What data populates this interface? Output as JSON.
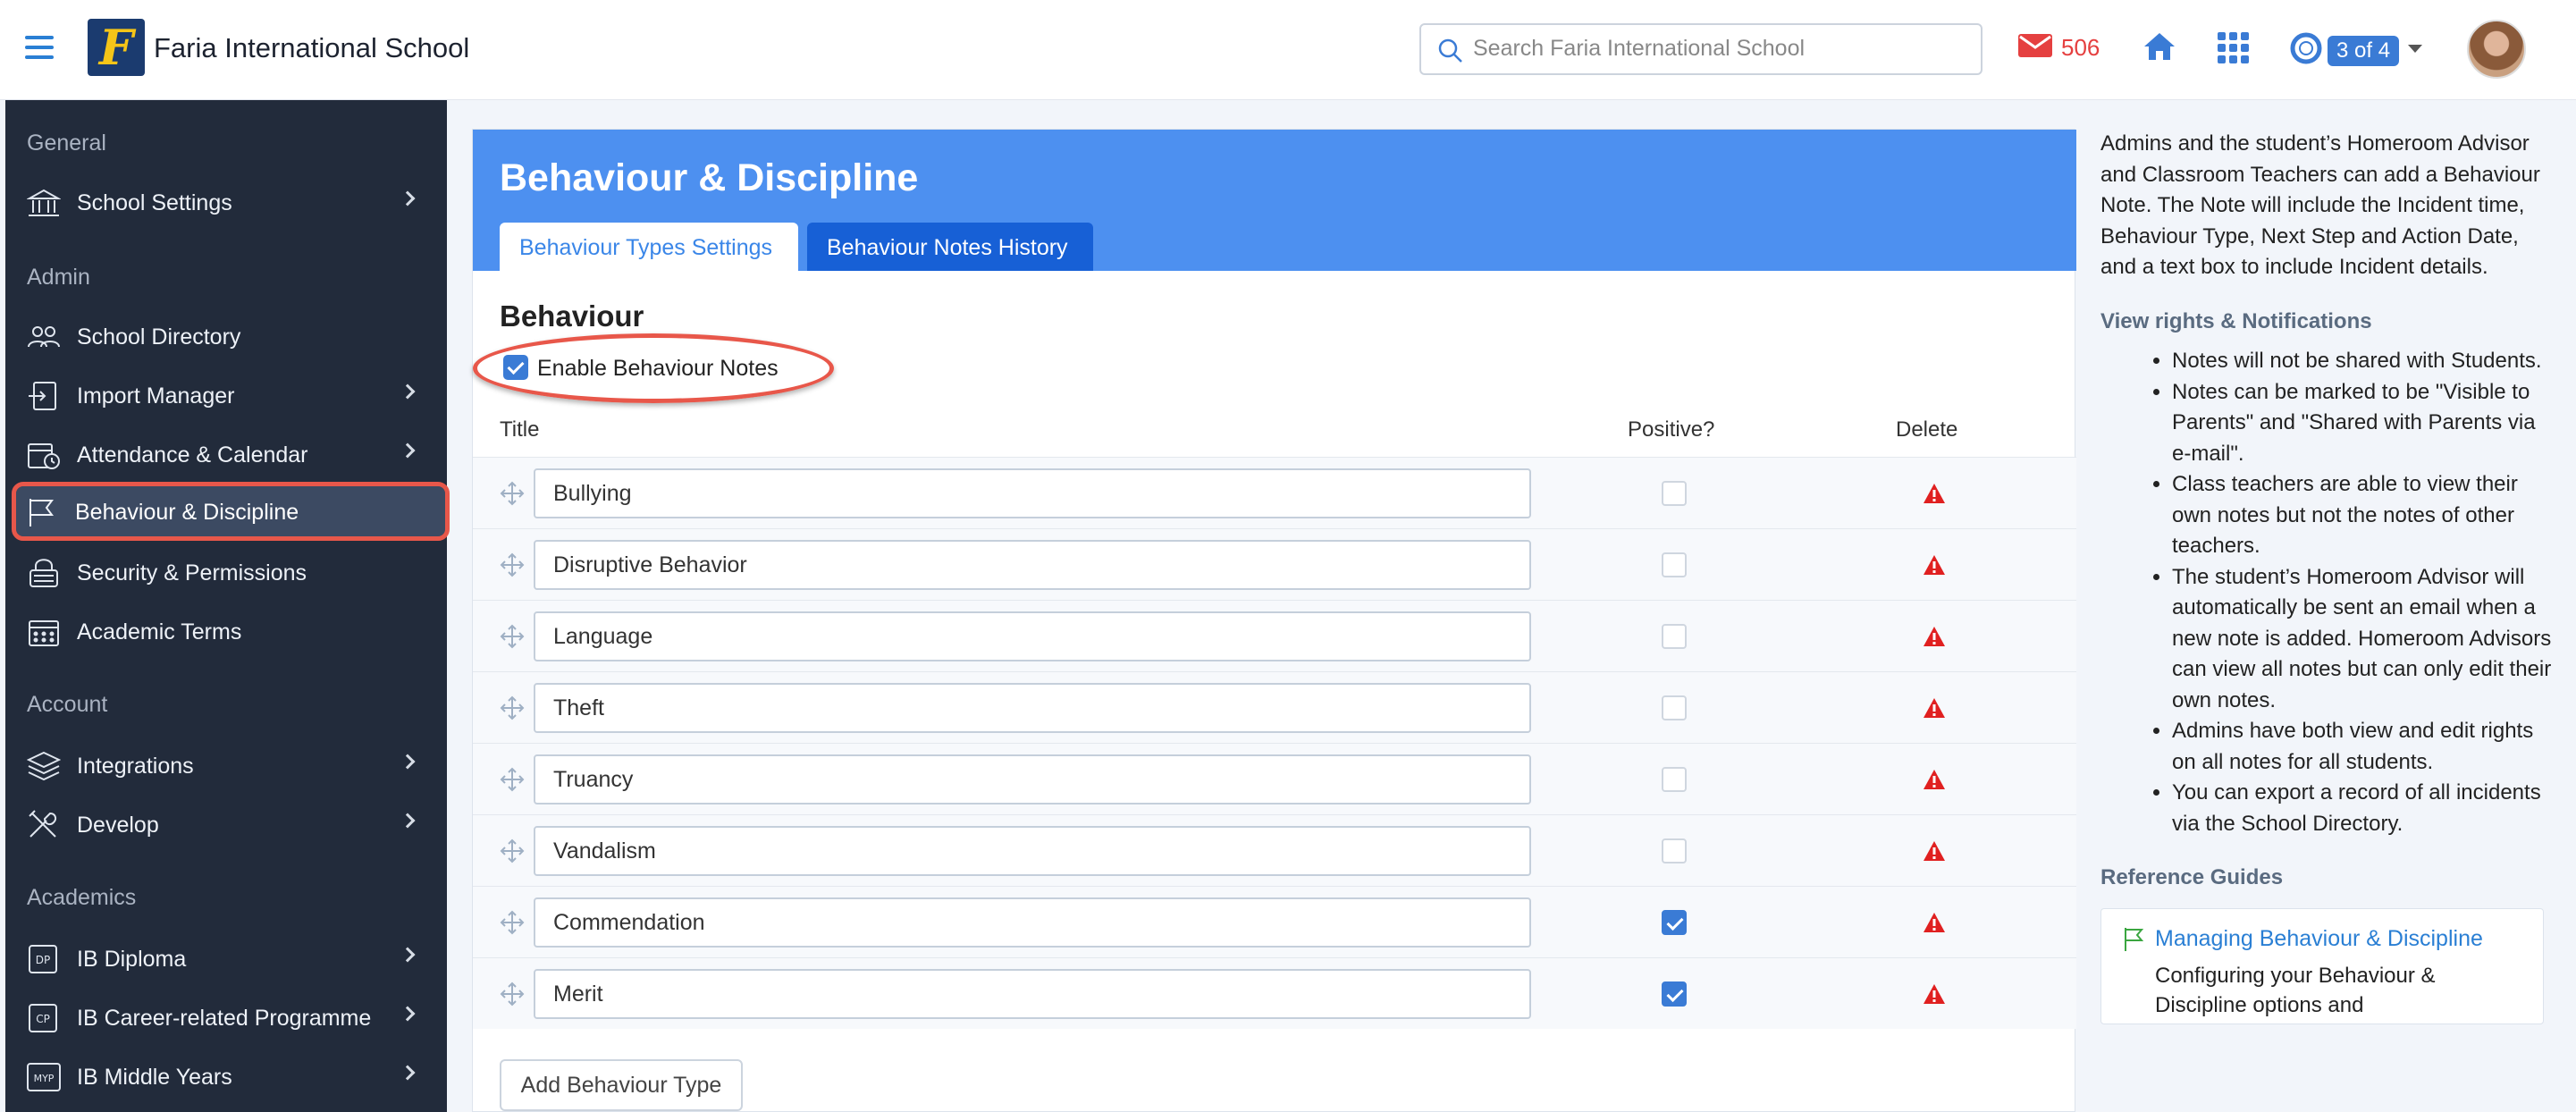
{
  "header": {
    "school_name": "Faria International School",
    "logo_letter": "F",
    "search_placeholder": "Search Faria International School",
    "mail_count": "506",
    "pager": "3 of 4"
  },
  "sidebar": {
    "sections": [
      {
        "label": "General"
      },
      {
        "label": "Admin"
      },
      {
        "label": "Account"
      },
      {
        "label": "Academics"
      }
    ],
    "items": [
      {
        "label": "School Settings",
        "icon": "bank-icon",
        "chevron": true
      },
      {
        "label": "School Directory",
        "icon": "people-icon",
        "chevron": false
      },
      {
        "label": "Import Manager",
        "icon": "import-icon",
        "chevron": true
      },
      {
        "label": "Attendance & Calendar",
        "icon": "calendar-clock-icon",
        "chevron": true
      },
      {
        "label": "Behaviour & Discipline",
        "icon": "flag-icon",
        "chevron": false,
        "active": true
      },
      {
        "label": "Security & Permissions",
        "icon": "lock-icon",
        "chevron": false
      },
      {
        "label": "Academic Terms",
        "icon": "calendar-icon",
        "chevron": false
      },
      {
        "label": "Integrations",
        "icon": "layers-icon",
        "chevron": true
      },
      {
        "label": "Develop",
        "icon": "tools-icon",
        "chevron": true
      },
      {
        "label": "IB Diploma",
        "icon": "dp-icon",
        "chevron": true
      },
      {
        "label": "IB Career-related Programme",
        "icon": "cp-icon",
        "chevron": true
      },
      {
        "label": "IB Middle Years",
        "icon": "myp-icon",
        "chevron": true
      }
    ]
  },
  "main": {
    "title": "Behaviour & Discipline",
    "tabs": [
      {
        "label": "Behaviour Types Settings",
        "active": true
      },
      {
        "label": "Behaviour Notes History",
        "active": false
      }
    ],
    "section_title": "Behaviour",
    "enable_label": "Enable Behaviour Notes",
    "enable_checked": true,
    "columns": {
      "title": "Title",
      "positive": "Positive?",
      "delete": "Delete"
    },
    "rows": [
      {
        "title": "Bullying",
        "positive": false
      },
      {
        "title": "Disruptive Behavior",
        "positive": false
      },
      {
        "title": "Language",
        "positive": false
      },
      {
        "title": "Theft",
        "positive": false
      },
      {
        "title": "Truancy",
        "positive": false
      },
      {
        "title": "Vandalism",
        "positive": false
      },
      {
        "title": "Commendation",
        "positive": true
      },
      {
        "title": "Merit",
        "positive": true
      }
    ],
    "add_button": "Add Behaviour Type"
  },
  "help": {
    "intro": "Admins and the student’s Homeroom Advisor and Classroom Teachers can add a Behaviour Note. The Note will include the Incident time, Behaviour Type, Next Step and Action Date, and a text box to include Incident details.",
    "rights_heading": "View rights & Notifications",
    "rights": [
      "Notes will not be shared with Students.",
      "Notes can be marked to be \"Visible to Parents\" and \"Shared with Parents via e-mail\".",
      "Class teachers are able to view their own notes but not the notes of other teachers.",
      "The student’s Homeroom Advisor will automatically be sent an email when a new note is added. Homeroom Advisors can view all notes but can only edit their own notes.",
      "Admins have both view and edit rights on all notes for all students.",
      "You can export a record of all incidents via the School Directory."
    ],
    "ref_heading": "Reference Guides",
    "ref_link": "Managing Behaviour & Discipline",
    "ref_desc": "Configuring your Behaviour & Discipline options and"
  },
  "colors": {
    "accent": "#4d90f0",
    "sidebar_bg": "#222b3b",
    "highlight": "#e8574a",
    "alert": "#e02020"
  }
}
